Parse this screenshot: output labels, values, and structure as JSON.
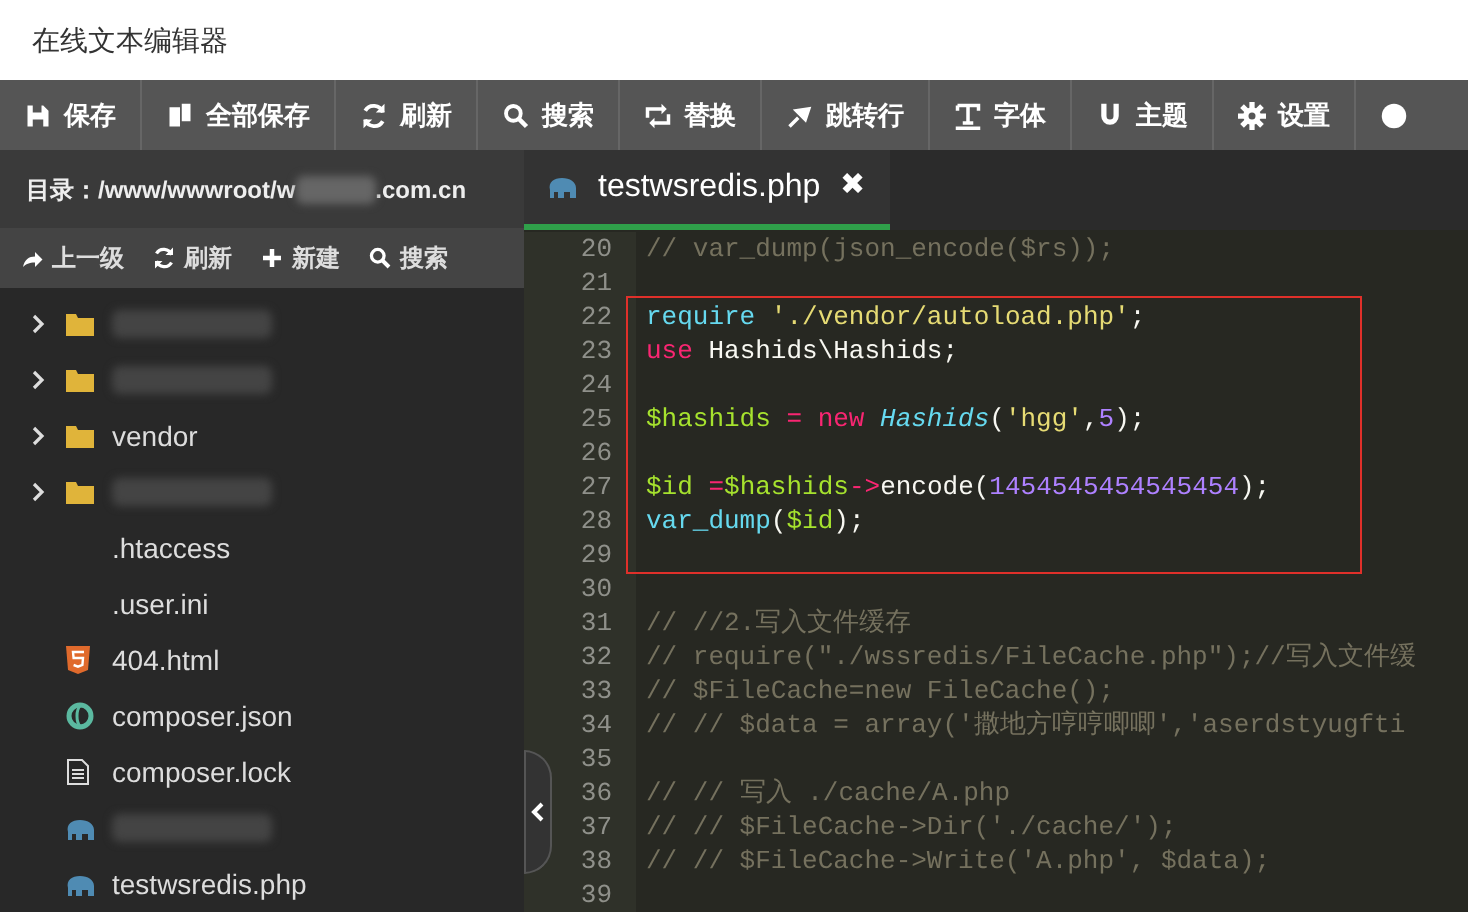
{
  "window": {
    "title": "在线文本编辑器"
  },
  "toolbar": [
    {
      "label": "保存"
    },
    {
      "label": "全部保存"
    },
    {
      "label": "刷新"
    },
    {
      "label": "搜索"
    },
    {
      "label": "替换"
    },
    {
      "label": "跳转行"
    },
    {
      "label": "字体"
    },
    {
      "label": "主题"
    },
    {
      "label": "设置"
    }
  ],
  "sidebar": {
    "directory_label": "目录：",
    "directory_path_start": "/www/wwwroot/w",
    "directory_path_end": ".com.cn",
    "actions": [
      {
        "label": "上一级"
      },
      {
        "label": "刷新"
      },
      {
        "label": "新建"
      },
      {
        "label": "搜索"
      }
    ],
    "files": [
      {
        "kind": "folder"
      },
      {
        "kind": "folder"
      },
      {
        "kind": "folder",
        "name": "vendor"
      },
      {
        "kind": "folder"
      },
      {
        "kind": "plain",
        "name": ".htaccess"
      },
      {
        "kind": "plain",
        "name": ".user.ini"
      },
      {
        "kind": "html",
        "name": "404.html"
      },
      {
        "kind": "json",
        "name": "composer.json"
      },
      {
        "kind": "text",
        "name": "composer.lock"
      },
      {
        "kind": "php"
      },
      {
        "kind": "php",
        "name": "testwsredis.php"
      }
    ]
  },
  "tabs": [
    {
      "kind": "php",
      "label": "testwsredis.php",
      "close": "✖",
      "selected": true
    }
  ],
  "editor": {
    "lines": [
      {
        "number": "20",
        "boxed": false,
        "tokens": [
          {
            "kind": "comment",
            "text": "// var_dump(json_encode($rs));"
          }
        ]
      },
      {
        "number": "21",
        "boxed": false
      },
      {
        "number": "22",
        "boxed": true,
        "tokens": [
          {
            "kind": "keyword",
            "text": "require "
          },
          {
            "kind": "string",
            "text": "'./vendor/autoload.php'"
          },
          {
            "kind": "plain",
            "text": ";"
          }
        ]
      },
      {
        "number": "23",
        "boxed": true,
        "tokens": [
          {
            "kind": "operator",
            "text": "use "
          },
          {
            "kind": "plain",
            "text": "Hashids\\Hashids;"
          }
        ]
      },
      {
        "number": "24",
        "boxed": true
      },
      {
        "number": "25",
        "boxed": true,
        "tokens": [
          {
            "kind": "variable",
            "text": "$hashids "
          },
          {
            "kind": "operator",
            "text": "= new "
          },
          {
            "kind": "class",
            "text": "Hashids"
          },
          {
            "kind": "plain",
            "text": "("
          },
          {
            "kind": "string",
            "text": "'hgg'"
          },
          {
            "kind": "plain",
            "text": ","
          },
          {
            "kind": "number",
            "text": "5"
          },
          {
            "kind": "plain",
            "text": ");"
          }
        ]
      },
      {
        "number": "26",
        "boxed": true
      },
      {
        "number": "27",
        "boxed": true,
        "tokens": [
          {
            "kind": "variable",
            "text": "$id "
          },
          {
            "kind": "operator",
            "text": "="
          },
          {
            "kind": "variable",
            "text": "$hashids"
          },
          {
            "kind": "operator",
            "text": "->"
          },
          {
            "kind": "plain",
            "text": "encode("
          },
          {
            "kind": "number",
            "text": "1454545454545454"
          },
          {
            "kind": "plain",
            "text": ");"
          }
        ]
      },
      {
        "number": "28",
        "boxed": true,
        "tokens": [
          {
            "kind": "keyword",
            "text": "var_dump"
          },
          {
            "kind": "plain",
            "text": "("
          },
          {
            "kind": "variable",
            "text": "$id"
          },
          {
            "kind": "plain",
            "text": ");"
          }
        ]
      },
      {
        "number": "29",
        "boxed": true
      },
      {
        "number": "30",
        "boxed": false
      },
      {
        "number": "31",
        "boxed": false,
        "tokens": [
          {
            "kind": "comment",
            "text": "// //2.写入文件缓存"
          }
        ]
      },
      {
        "number": "32",
        "boxed": false,
        "tokens": [
          {
            "kind": "comment",
            "text": "// require(\"./wssredis/FileCache.php\");//写入文件缓"
          }
        ]
      },
      {
        "number": "33",
        "boxed": false,
        "tokens": [
          {
            "kind": "comment",
            "text": "// $FileCache=new FileCache();"
          }
        ]
      },
      {
        "number": "34",
        "boxed": false,
        "tokens": [
          {
            "kind": "comment",
            "text": "// // $data = array('撒地方哼哼唧唧','aserdstyugfti"
          }
        ]
      },
      {
        "number": "35",
        "boxed": false
      },
      {
        "number": "36",
        "boxed": false,
        "tokens": [
          {
            "kind": "comment",
            "text": "// // 写入 ./cache/A.php"
          }
        ]
      },
      {
        "number": "37",
        "boxed": false,
        "tokens": [
          {
            "kind": "comment",
            "text": "// // $FileCache->Dir('./cache/');"
          }
        ]
      },
      {
        "number": "38",
        "boxed": false,
        "tokens": [
          {
            "kind": "comment",
            "text": "// // $FileCache->Write('A.php', $data);"
          }
        ]
      },
      {
        "number": "39",
        "boxed": false
      }
    ]
  }
}
